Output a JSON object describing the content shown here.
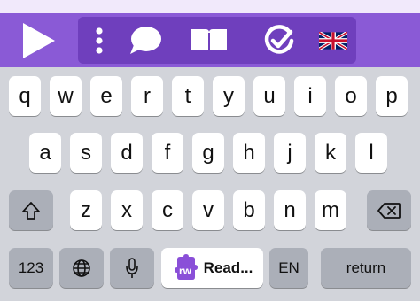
{
  "toolbar": {
    "background": "#8a5ad6",
    "group_background": "#6f3fbd",
    "buttons": [
      {
        "name": "play-icon"
      },
      {
        "name": "more-vertical-icon"
      },
      {
        "name": "speech-bubble-icon"
      },
      {
        "name": "open-book-icon"
      },
      {
        "name": "check-circle-icon"
      },
      {
        "name": "uk-flag-icon"
      }
    ]
  },
  "keyboard": {
    "row1": [
      "q",
      "w",
      "e",
      "r",
      "t",
      "y",
      "u",
      "i",
      "o",
      "p"
    ],
    "row2": [
      "a",
      "s",
      "d",
      "f",
      "g",
      "h",
      "j",
      "k",
      "l"
    ],
    "row3": [
      "z",
      "x",
      "c",
      "v",
      "b",
      "n",
      "m"
    ],
    "numbers_key": "123",
    "globe_icon": "globe-icon",
    "mic_icon": "microphone-icon",
    "rw_logo_text": "rw",
    "read_label": "Read...",
    "lang_key": "EN",
    "return_key": "return",
    "shift_icon": "shift-icon",
    "backspace_icon": "backspace-icon"
  }
}
